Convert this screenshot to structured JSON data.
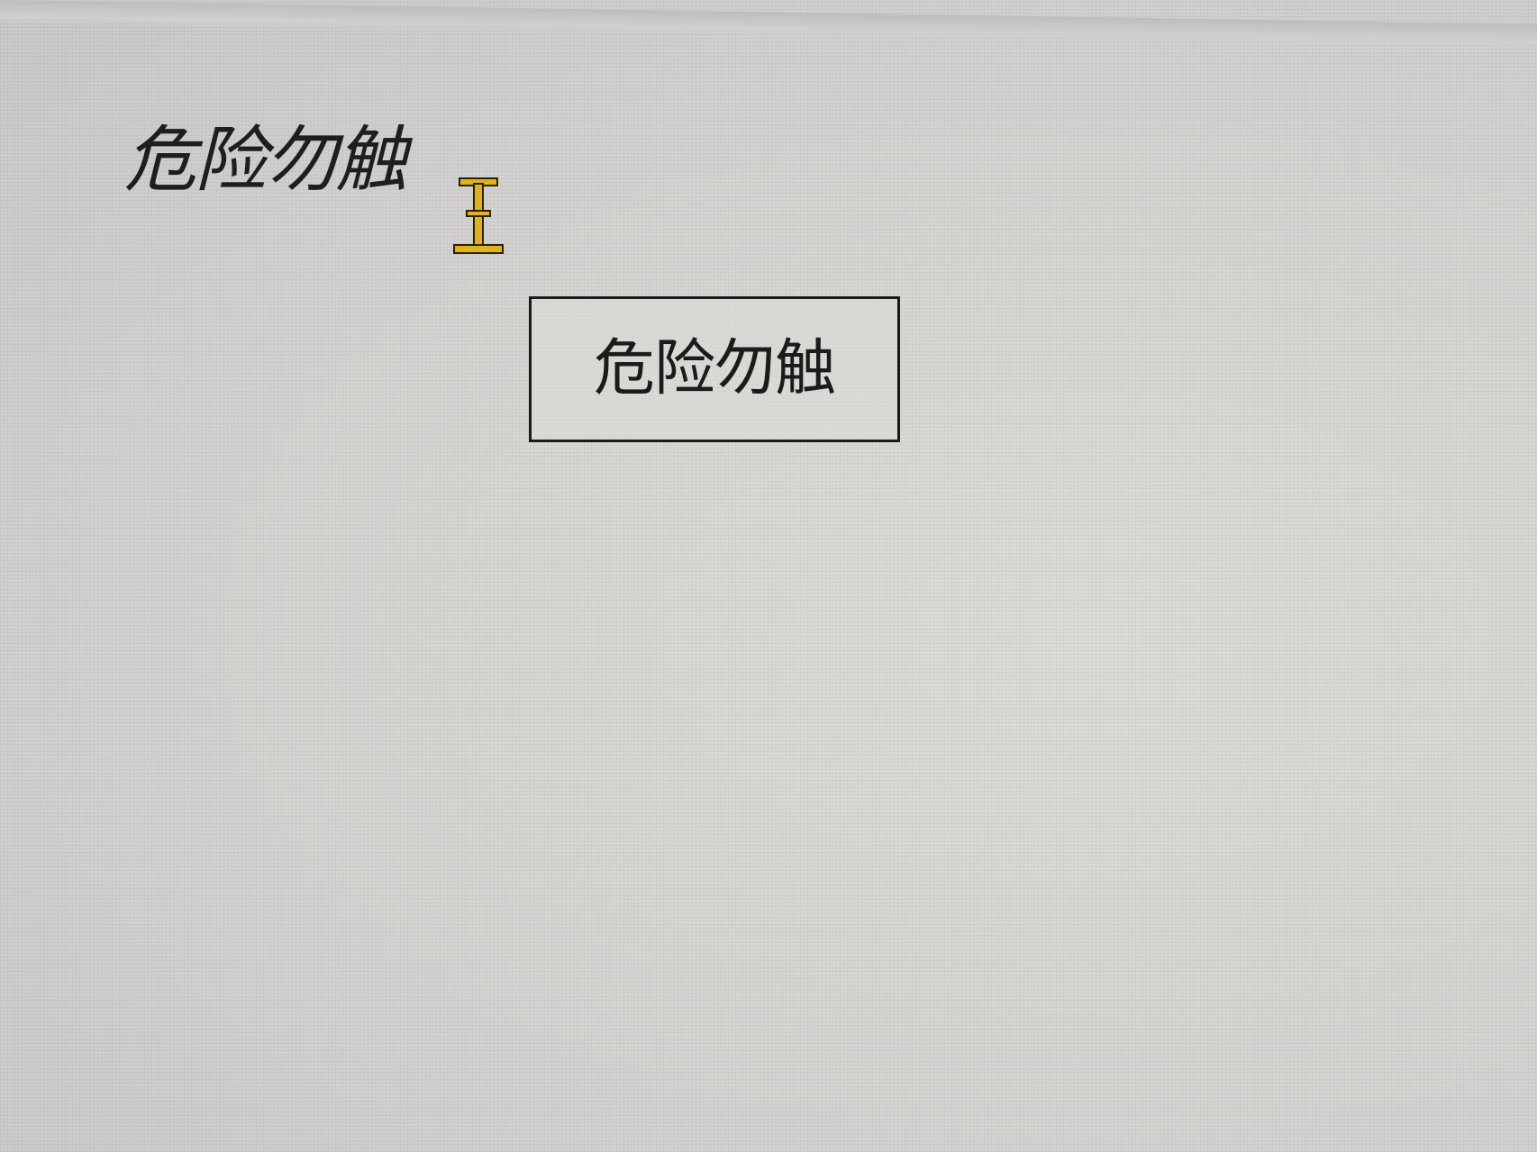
{
  "window": {
    "background_color": "#d6d5d2"
  },
  "content": {
    "heading_text": "危险勿触",
    "button_label": "危险勿触"
  },
  "cursor": {
    "icon": "text-ibeam-cursor-icon",
    "color": "#e0b21c"
  }
}
